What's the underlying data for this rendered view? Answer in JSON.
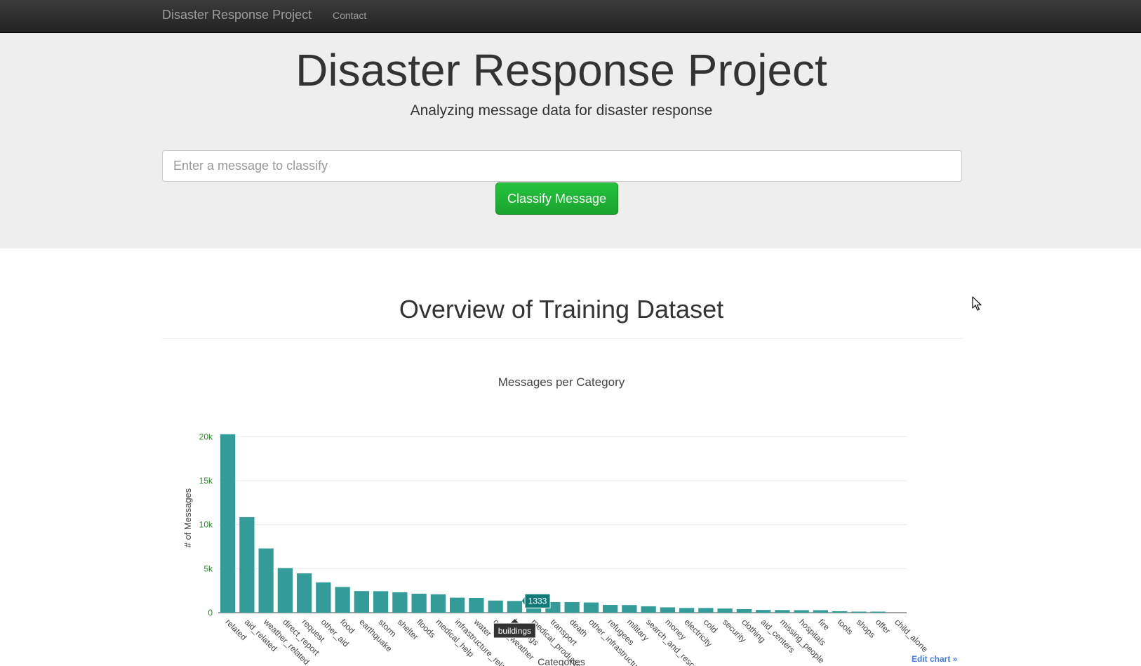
{
  "navbar": {
    "brand": "Disaster Response Project",
    "contact": "Contact"
  },
  "jumbotron": {
    "title": "Disaster Response Project",
    "subtitle": "Analyzing message data for disaster response",
    "input_placeholder": "Enter a message to classify",
    "button_label": "Classify Message"
  },
  "overview": {
    "title": "Overview of Training Dataset"
  },
  "chart_links": {
    "edit": "Edit chart »"
  },
  "colors": {
    "bar": "#339c99",
    "hover_label": "#107a78",
    "tick_y": "#2b8a2b",
    "navbar": "#222222",
    "button": "#1fb538"
  },
  "icons": {
    "cursor": "mouse-pointer-icon"
  },
  "chart_data": {
    "type": "bar",
    "title": "Messages per Category",
    "xlabel": "Categories",
    "ylabel": "# of Messages",
    "ylim": [
      0,
      20500
    ],
    "y_ticks": [
      0,
      5000,
      10000,
      15000,
      20000
    ],
    "y_tick_labels": [
      "0",
      "5k",
      "10k",
      "15k",
      "20k"
    ],
    "grid": true,
    "categories": [
      "related",
      "aid_related",
      "weather_related",
      "direct_report",
      "request",
      "other_aid",
      "food",
      "earthquake",
      "storm",
      "shelter",
      "floods",
      "medical_help",
      "infrastructure_related",
      "water",
      "other_weather",
      "buildings",
      "medical_products",
      "transport",
      "death",
      "other_infrastructure",
      "refugees",
      "military",
      "search_and_rescue",
      "money",
      "electricity",
      "cold",
      "security",
      "clothing",
      "aid_centers",
      "missing_people",
      "hospitals",
      "fire",
      "tools",
      "shops",
      "offer",
      "child_alone"
    ],
    "values": [
      20282,
      10860,
      7297,
      5075,
      4474,
      3446,
      2923,
      2455,
      2443,
      2314,
      2155,
      2084,
      1705,
      1672,
      1376,
      1333,
      1313,
      1201,
      1194,
      1151,
      875,
      860,
      724,
      604,
      532,
      530,
      471,
      405,
      309,
      298,
      283,
      282,
      159,
      120,
      118,
      0
    ],
    "hover": {
      "category": "buildings",
      "value_label": "1333",
      "category_label": "buildings"
    }
  }
}
